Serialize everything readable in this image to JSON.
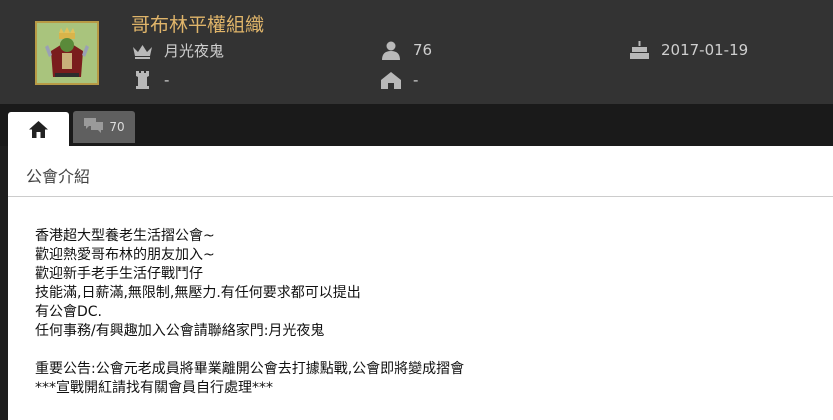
{
  "guild": {
    "name": "哥布林平權組織",
    "leader": "月光夜鬼",
    "members": "76",
    "created": "2017-01-19",
    "field_a": "-",
    "field_b": "-"
  },
  "icons": {
    "leader": "crown-icon",
    "members": "person-icon",
    "created": "cake-icon",
    "field_a": "tower-icon",
    "field_b": "house-icon",
    "home_tab": "home-icon",
    "comments_tab": "chat-bubbles-icon"
  },
  "tabs": {
    "comments_count": "70"
  },
  "section": {
    "title": "公會介紹",
    "lines": [
      "香港超大型養老生活摺公會~",
      "歡迎熱愛哥布林的朋友加入~",
      "歡迎新手老手生活仔戰鬥仔",
      "技能滿,日薪滿,無限制,無壓力.有任何要求都可以提出",
      "有公會DC.",
      "任何事務/有興趣加入公會請聯絡家門:月光夜鬼",
      "",
      "重要公告:公會元老成員將畢業離開公會去打據點戰,公會即將變成摺會",
      "***宣戰開紅請找有關會員自行處理***"
    ]
  },
  "colors": {
    "header_bg": "#333333",
    "guild_name": "#e0b56a",
    "icon": "#b9b9b9"
  }
}
